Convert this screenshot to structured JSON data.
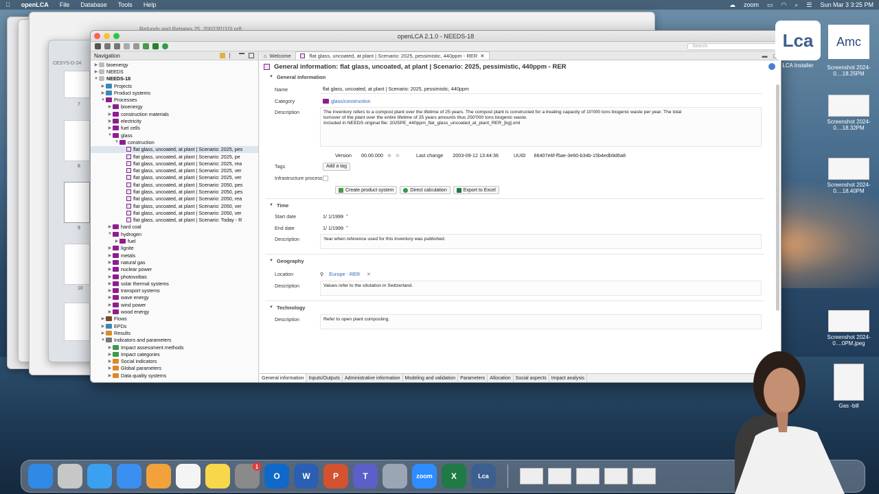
{
  "menubar": {
    "app": "openLCA",
    "menus": [
      "File",
      "Database",
      "Tools",
      "Help"
    ],
    "zoom": "zoom",
    "datetime": "Sun Mar 3  3:25 PM"
  },
  "window": {
    "title": "openLCA 2.1.0 - NEEDS-18",
    "search_placeholder": "Search",
    "behind_title": "Refunds and Rebates  25_20023f1[10].pdf"
  },
  "navigation": {
    "header": "Navigation",
    "tree": [
      {
        "label": "bioenergy",
        "depth": 1,
        "icon": "db"
      },
      {
        "label": "NEEDS",
        "depth": 1,
        "icon": "db"
      },
      {
        "label": "NEEDS-18",
        "depth": 1,
        "icon": "db",
        "expanded": true,
        "bold": true
      },
      {
        "label": "Projects",
        "depth": 2,
        "icon": "folder-blue"
      },
      {
        "label": "Product systems",
        "depth": 2,
        "icon": "folder-blue"
      },
      {
        "label": "Processes",
        "depth": 2,
        "icon": "folder-purple",
        "expanded": true
      },
      {
        "label": "bioenergy",
        "depth": 3,
        "icon": "folder-purple"
      },
      {
        "label": "construction materials",
        "depth": 3,
        "icon": "folder-purple"
      },
      {
        "label": "electricity",
        "depth": 3,
        "icon": "folder-purple"
      },
      {
        "label": "fuel cells",
        "depth": 3,
        "icon": "folder-purple"
      },
      {
        "label": "glass",
        "depth": 3,
        "icon": "folder-purple",
        "expanded": true
      },
      {
        "label": "construction",
        "depth": 4,
        "icon": "folder-purple",
        "expanded": true
      },
      {
        "label": "flat glass, uncoated, at plant | Scenario: 2025, pes",
        "depth": 5,
        "icon": "process",
        "selected": true
      },
      {
        "label": "flat glass, uncoated, at plant | Scenario: 2025, pe",
        "depth": 5,
        "icon": "process"
      },
      {
        "label": "flat glass, uncoated, at plant | Scenario: 2025, rea",
        "depth": 5,
        "icon": "process"
      },
      {
        "label": "flat glass, uncoated, at plant | Scenario: 2025, ver",
        "depth": 5,
        "icon": "process"
      },
      {
        "label": "flat glass, uncoated, at plant | Scenario: 2025, ver",
        "depth": 5,
        "icon": "process"
      },
      {
        "label": "flat glass, uncoated, at plant | Scenario: 2050, pes",
        "depth": 5,
        "icon": "process"
      },
      {
        "label": "flat glass, uncoated, at plant | Scenario: 2050, pes",
        "depth": 5,
        "icon": "process"
      },
      {
        "label": "flat glass, uncoated, at plant | Scenario: 2050, rea",
        "depth": 5,
        "icon": "process"
      },
      {
        "label": "flat glass, uncoated, at plant | Scenario: 2050, ver",
        "depth": 5,
        "icon": "process"
      },
      {
        "label": "flat glass, uncoated, at plant | Scenario: 2050, ver",
        "depth": 5,
        "icon": "process"
      },
      {
        "label": "flat glass, uncoated, at plant | Scenario: Today - R",
        "depth": 5,
        "icon": "process"
      },
      {
        "label": "hard coal",
        "depth": 3,
        "icon": "folder-purple"
      },
      {
        "label": "hydrogen",
        "depth": 3,
        "icon": "folder-purple",
        "expanded": true
      },
      {
        "label": "fuel",
        "depth": 4,
        "icon": "folder-purple"
      },
      {
        "label": "lignite",
        "depth": 3,
        "icon": "folder-purple"
      },
      {
        "label": "metals",
        "depth": 3,
        "icon": "folder-purple"
      },
      {
        "label": "natural gas",
        "depth": 3,
        "icon": "folder-purple"
      },
      {
        "label": "nuclear power",
        "depth": 3,
        "icon": "folder-purple"
      },
      {
        "label": "photovoltaic",
        "depth": 3,
        "icon": "folder-purple"
      },
      {
        "label": "solar thermal systems",
        "depth": 3,
        "icon": "folder-purple"
      },
      {
        "label": "transport systems",
        "depth": 3,
        "icon": "folder-purple"
      },
      {
        "label": "wave energy",
        "depth": 3,
        "icon": "folder-purple"
      },
      {
        "label": "wind power",
        "depth": 3,
        "icon": "folder-purple"
      },
      {
        "label": "wood energy",
        "depth": 3,
        "icon": "folder-purple"
      },
      {
        "label": "Flows",
        "depth": 2,
        "icon": "folder-brown"
      },
      {
        "label": "EPDs",
        "depth": 2,
        "icon": "folder-blue"
      },
      {
        "label": "Results",
        "depth": 2,
        "icon": "folder-orange"
      },
      {
        "label": "Indicators and parameters",
        "depth": 2,
        "icon": "folder-gray",
        "expanded": true
      },
      {
        "label": "Impact assessment methods",
        "depth": 3,
        "icon": "folder-green"
      },
      {
        "label": "Impact categories",
        "depth": 3,
        "icon": "folder-green"
      },
      {
        "label": "Social indicators",
        "depth": 3,
        "icon": "folder-orange"
      },
      {
        "label": "Global parameters",
        "depth": 3,
        "icon": "folder-orange"
      },
      {
        "label": "Data quality systems",
        "depth": 3,
        "icon": "folder-orange"
      }
    ]
  },
  "editor": {
    "tabs": [
      "Welcome",
      "flat glass, uncoated, at plant | Scenario: 2025, pessimistic, 440ppm - RER"
    ],
    "title": "General information: flat glass, uncoated, at plant | Scenario: 2025, pessimistic, 440ppm - RER",
    "general": {
      "section": "General information",
      "name_label": "Name",
      "name_value": "flat glass, uncoated, at plant | Scenario: 2025, pessimistic, 440ppm",
      "category_label": "Category",
      "category_value": "glass/construction",
      "description_label": "Description",
      "description_lines": [
        "The inventory refers to a compost plant over the lifetime of 25 years. The compost plant is constructed for a treating capacity of 10'000 tons biogenic waste per year. The total",
        "turnover of the plant over the entire lifetime of 25 years amounts thus 250'000 tons biogenic waste.",
        "Included in NEEDS original file: 2025PE_440ppm_flat_glass_uncoated_at_plant_RER_[kg].xml"
      ],
      "version_label": "Version",
      "version_value": "00.00.000",
      "last_change_label": "Last change",
      "last_change_value": "2003-09-12 13:44:36",
      "uuid_label": "UUID",
      "uuid_value": "66407e6f-f5ae-3e60-b34b-15b4edb9d6a8",
      "tags_label": "Tags",
      "add_tag": "Add a tag",
      "infra_label": "Infrastructure process",
      "btn_create": "Create product system",
      "btn_direct": "Direct calculation",
      "btn_excel": "Export to Excel"
    },
    "time": {
      "section": "Time",
      "start_label": "Start date",
      "start_value": "1/  1/1999",
      "end_label": "End date",
      "end_value": "1/  1/1999",
      "desc_label": "Description",
      "desc_value": "Year when reference used for this inventory was published."
    },
    "geography": {
      "section": "Geography",
      "location_label": "Location",
      "location_value": "Europe - RER",
      "desc_label": "Description",
      "desc_value": "Values refer to the situtation in Switzerland."
    },
    "technology": {
      "section": "Technology",
      "desc_label": "Description",
      "desc_value": "Refer to open plant composting."
    },
    "bottom_tabs": [
      "General information",
      "Inputs/Outputs",
      "Administrative information",
      "Modeling and validation",
      "Parameters",
      "Allocation",
      "Social aspects",
      "Impact analysis"
    ]
  },
  "desktop": {
    "icons": [
      {
        "label": "LCA Installer"
      },
      {
        "label": "Amc"
      },
      {
        "label": "Screenshot 2024-0....18.25PM"
      },
      {
        "label": "Screenshot 2024-0....18.32PM"
      },
      {
        "label": "Screenshot 2024-0....18.40PM"
      },
      {
        "label": "Screenshot 2024-0....0PM.jpeg"
      },
      {
        "label": "Gas -bill"
      }
    ],
    "side_window": {
      "label": "CESYS-D-24",
      "pages": [
        "7",
        "8",
        "9",
        "10"
      ]
    }
  },
  "dock": {
    "apps": [
      {
        "name": "Finder",
        "label": "",
        "color": "#2f8ae6"
      },
      {
        "name": "Launchpad",
        "label": "",
        "color": "#c7c7c7"
      },
      {
        "name": "Safari",
        "label": "",
        "color": "#3aa1f0"
      },
      {
        "name": "Mail",
        "label": "",
        "color": "#3b8ff0"
      },
      {
        "name": "Photos",
        "label": "",
        "color": "#f2a23a"
      },
      {
        "name": "Reminders",
        "label": "",
        "color": "#f4f4f4"
      },
      {
        "name": "Notes",
        "label": "",
        "color": "#f7d84a"
      },
      {
        "name": "System Settings",
        "label": "",
        "color": "#8a8a8a",
        "badge": "1"
      },
      {
        "name": "Outlook",
        "label": "O",
        "color": "#1068c9"
      },
      {
        "name": "Word",
        "label": "W",
        "color": "#2b5fb3"
      },
      {
        "name": "PowerPoint",
        "label": "P",
        "color": "#d35230"
      },
      {
        "name": "Teams",
        "label": "T",
        "color": "#5b5fc7"
      },
      {
        "name": "Preview",
        "label": "",
        "color": "#9aa6b4"
      },
      {
        "name": "Zoom",
        "label": "zoom",
        "color": "#2d8cff"
      },
      {
        "name": "Excel",
        "label": "X",
        "color": "#1f7a45"
      },
      {
        "name": "openLCA",
        "label": "Lca",
        "color": "#3c5f8f"
      }
    ]
  }
}
